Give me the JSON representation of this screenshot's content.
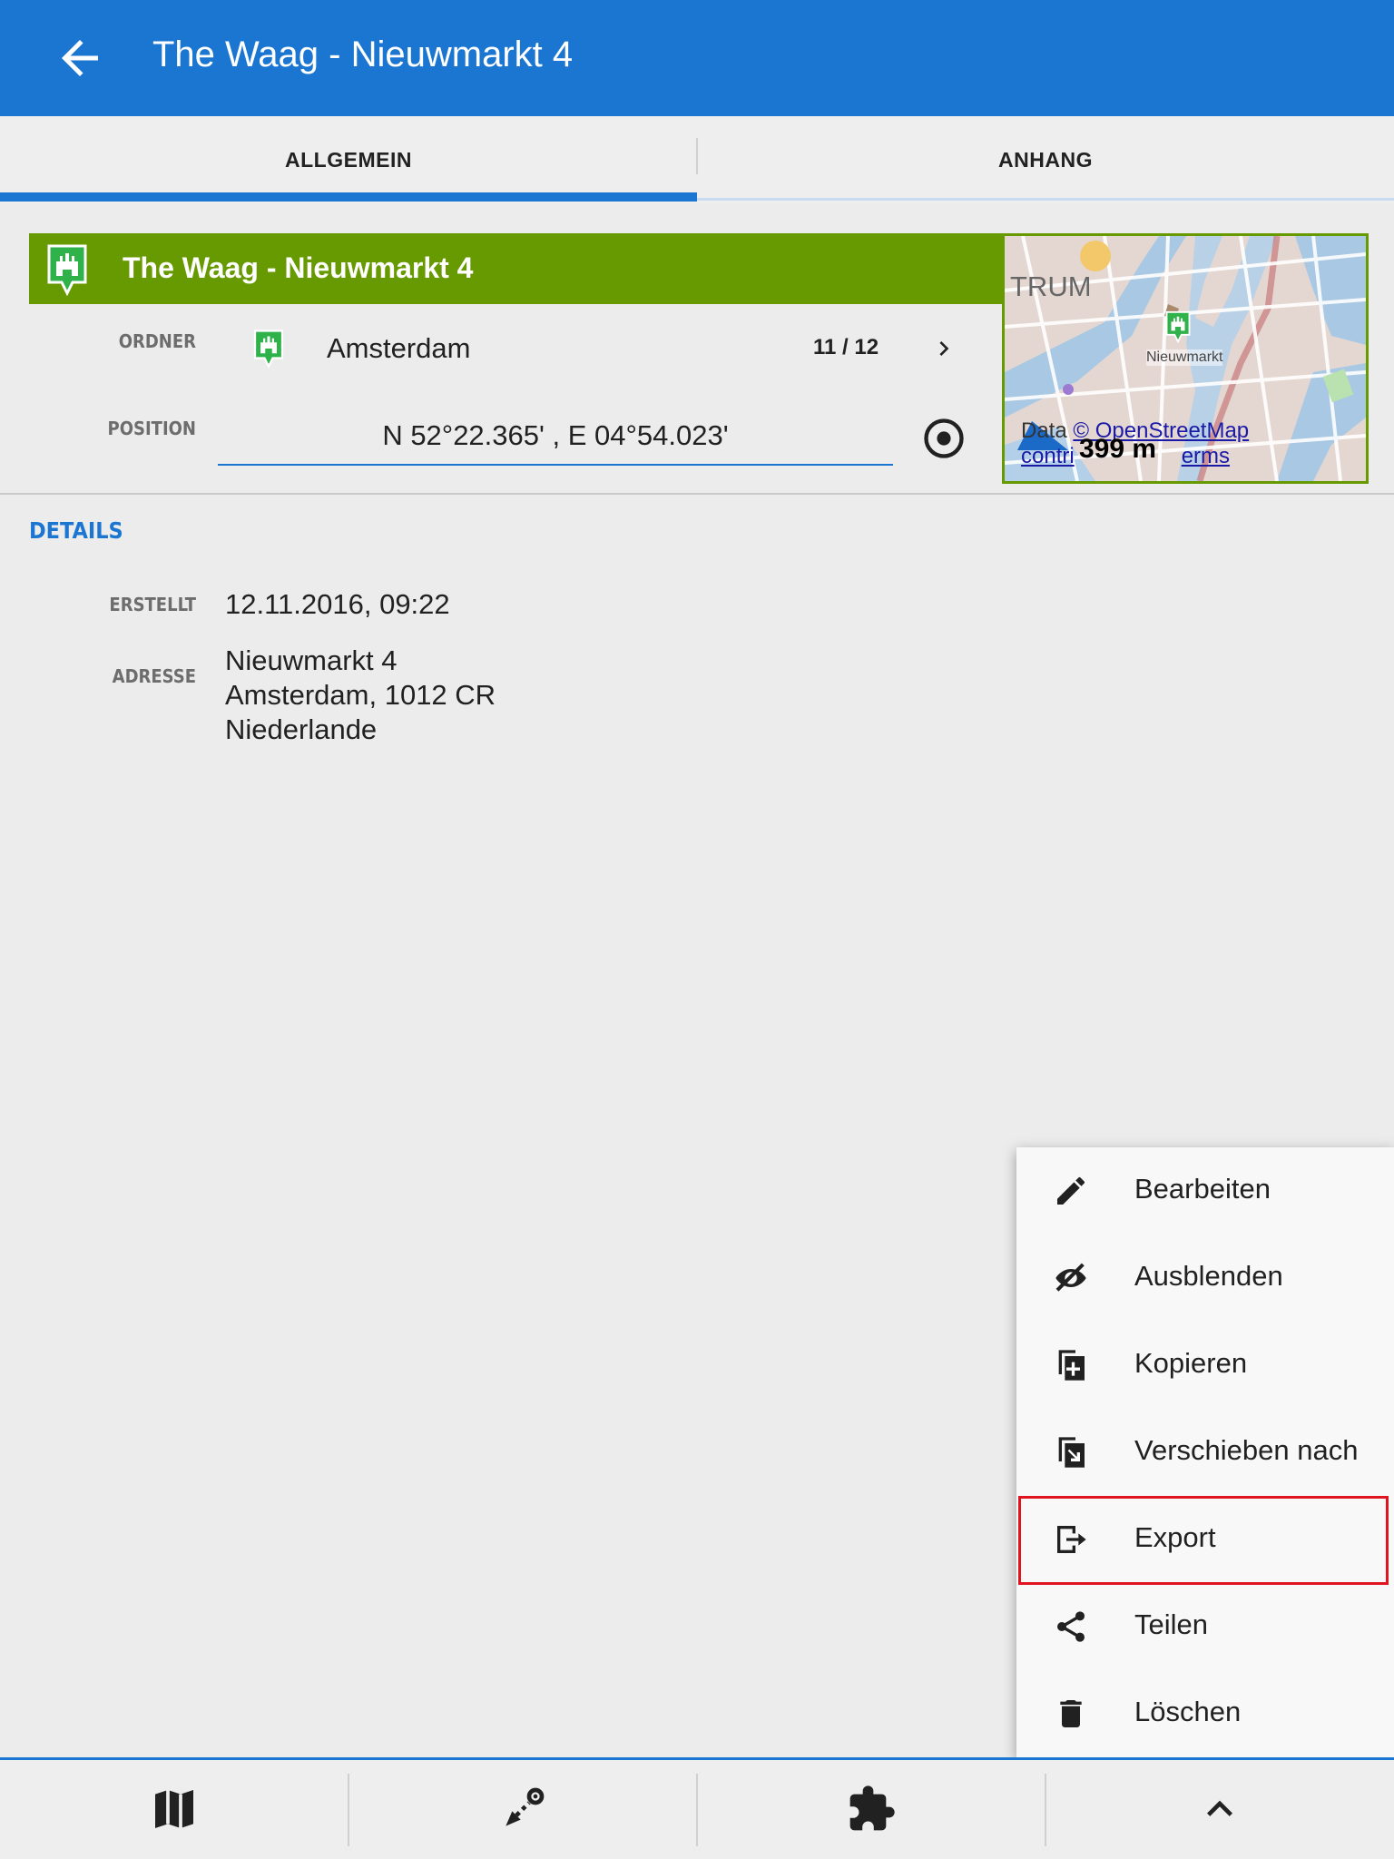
{
  "appbar": {
    "title": "The Waag - Nieuwmarkt 4",
    "back_icon": "arrow-back-icon"
  },
  "tabs": [
    {
      "label": "ALLGEMEIN",
      "selected": true
    },
    {
      "label": "ANHANG",
      "selected": false
    }
  ],
  "point": {
    "name": "The Waag - Nieuwmarkt 4",
    "folder_label": "ORDNER",
    "folder": "Amsterdam",
    "counter": "11 / 12",
    "position_label": "POSITION",
    "position": "N 52°22.365' , E 04°54.023'"
  },
  "map": {
    "district": "TRUM",
    "place_label": "Nieuwmarkt",
    "attribution_line1_prefix": "Data ",
    "attribution_link": "© OpenStreetMap",
    "attribution_line2_prefix": "contri",
    "attribution_line2_link": "erms",
    "scale": "399 m"
  },
  "details": {
    "heading": "DETAILS",
    "created_label": "ERSTELLT",
    "created": "12.11.2016, 09:22",
    "address_label": "ADRESSE",
    "address_line1": "Nieuwmarkt 4",
    "address_line2": "Amsterdam, 1012 CR",
    "address_line3": "Niederlande"
  },
  "menu": [
    {
      "label": "Bearbeiten",
      "icon": "pencil-icon"
    },
    {
      "label": "Ausblenden",
      "icon": "eye-off-icon"
    },
    {
      "label": "Kopieren",
      "icon": "copy-icon"
    },
    {
      "label": "Verschieben nach",
      "icon": "move-icon"
    },
    {
      "label": "Export",
      "icon": "export-icon",
      "highlighted": true
    },
    {
      "label": "Teilen",
      "icon": "share-icon"
    },
    {
      "label": "Löschen",
      "icon": "trash-icon"
    }
  ],
  "bottom_nav": [
    "map-icon",
    "navigation-icon",
    "puzzle-icon",
    "chevron-up-icon"
  ],
  "colors": {
    "primary": "#1b76d2",
    "header_green": "#679a00",
    "highlight_red": "#e0141e"
  }
}
